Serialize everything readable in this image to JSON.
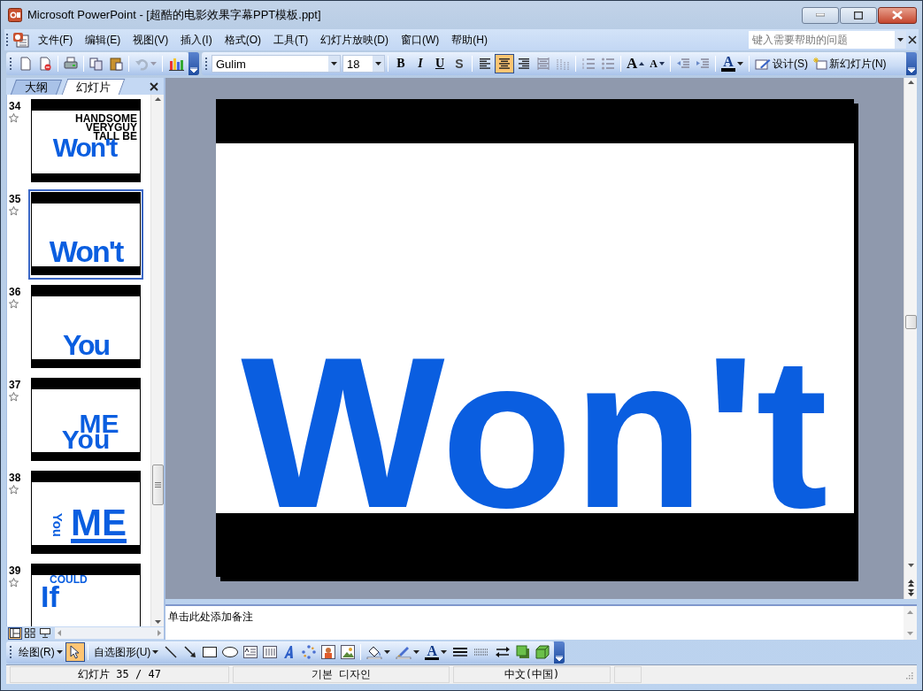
{
  "title_bar": {
    "title": "Microsoft PowerPoint - [超酷的电影效果字幕PPT模板.ppt]"
  },
  "menu_bar": {
    "items": [
      "文件(F)",
      "编辑(E)",
      "视图(V)",
      "插入(I)",
      "格式(O)",
      "工具(T)",
      "幻灯片放映(D)",
      "窗口(W)",
      "帮助(H)"
    ],
    "help_box": {
      "placeholder": "键入需要帮助的问题"
    }
  },
  "toolbar": {
    "font": "Gulim",
    "font_size": "18",
    "format_buttons": [
      "B",
      "I",
      "U",
      "S"
    ],
    "align_buttons": [
      {
        "selected": false
      },
      {
        "selected": true
      },
      {
        "selected": false
      }
    ],
    "font_grow": "A",
    "font_shrink": "A",
    "font_color": "A",
    "design_button": "设计(S)",
    "new_slide_button": "新幻灯片(N)"
  },
  "pane_tabs": [
    {
      "label": "大纲",
      "selected": false
    },
    {
      "label": "幻灯片",
      "selected": true
    }
  ],
  "slides": [
    {
      "number": "34",
      "selected": false,
      "texts": [
        {
          "text": "HANDSOME",
          "color": "#000000"
        },
        {
          "text": "VERYGUY",
          "color": "#000000"
        },
        {
          "text": "TALL BE",
          "color": "#000000"
        },
        {
          "text": "Won't",
          "color": "#0a5ee0"
        }
      ]
    },
    {
      "number": "35",
      "selected": true,
      "texts": [
        {
          "text": "Won't",
          "color": "#0a5ee0"
        }
      ]
    },
    {
      "number": "36",
      "selected": false,
      "texts": [
        {
          "text": "You",
          "color": "#0a5ee0"
        }
      ]
    },
    {
      "number": "37",
      "selected": false,
      "texts": [
        {
          "text": "ME",
          "color": "#0a5ee0"
        },
        {
          "text": "You",
          "color": "#0a5ee0"
        }
      ]
    },
    {
      "number": "38",
      "selected": false,
      "texts": [
        {
          "text": "You",
          "color": "#0a5ee0"
        },
        {
          "text": "ME",
          "color": "#0a5ee0"
        }
      ]
    },
    {
      "number": "39",
      "selected": false,
      "texts": [
        {
          "text": "COULD",
          "color": "#0a5ee0"
        },
        {
          "text": "If",
          "color": "#0a5ee0"
        }
      ]
    }
  ],
  "main_slide": {
    "text": "Won't"
  },
  "notes": {
    "placeholder": "单击此处添加备注"
  },
  "drawing_toolbar": {
    "draw_menu": "绘图(R)",
    "select_selected": true,
    "autoshapes_menu": "自选图形(U)",
    "font_color": "A"
  },
  "status_bar": [
    "幻灯片 35 / 47",
    "기본 디자인",
    "中文(中国)"
  ]
}
